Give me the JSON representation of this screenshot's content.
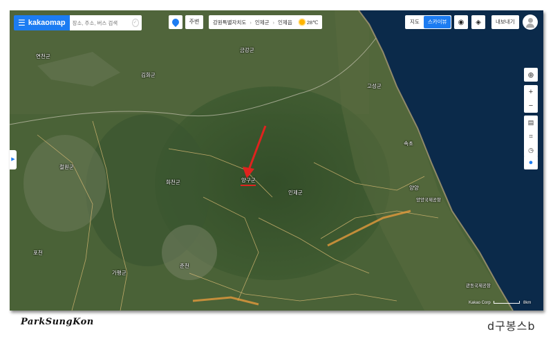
{
  "app": {
    "menu_icon": "hamburger-icon",
    "brand": "kakaomap"
  },
  "search": {
    "placeholder": "장소, 주소, 버스 검색",
    "clear_icon": "clear-icon"
  },
  "toolbar": {
    "nearby_label": "주변"
  },
  "breadcrumb": {
    "items": [
      "강원특별자치도",
      "인제군",
      "인제읍"
    ],
    "weather": "28℃",
    "weather_icon": "sun-icon"
  },
  "map_type": {
    "map_label": "지도",
    "skyview_label": "스카이뷰",
    "selected": "스카이뷰"
  },
  "export": {
    "label": "내보내기"
  },
  "map": {
    "labels": [
      "금강군",
      "김화군",
      "고성군",
      "속초",
      "양양",
      "인제군",
      "양구군",
      "화천군",
      "철원군",
      "포천",
      "춘천",
      "가평군",
      "연천군",
      "양양국제공항",
      "관동국제공항"
    ],
    "scale": "8km",
    "copyright": "Kakao Corp"
  },
  "colors": {
    "accent": "#1c7cf2",
    "arrow": "#e0231e",
    "sea": "#0b2a4a"
  },
  "signature": {
    "left": "ParkSungKon",
    "right": "d구봉스b"
  }
}
